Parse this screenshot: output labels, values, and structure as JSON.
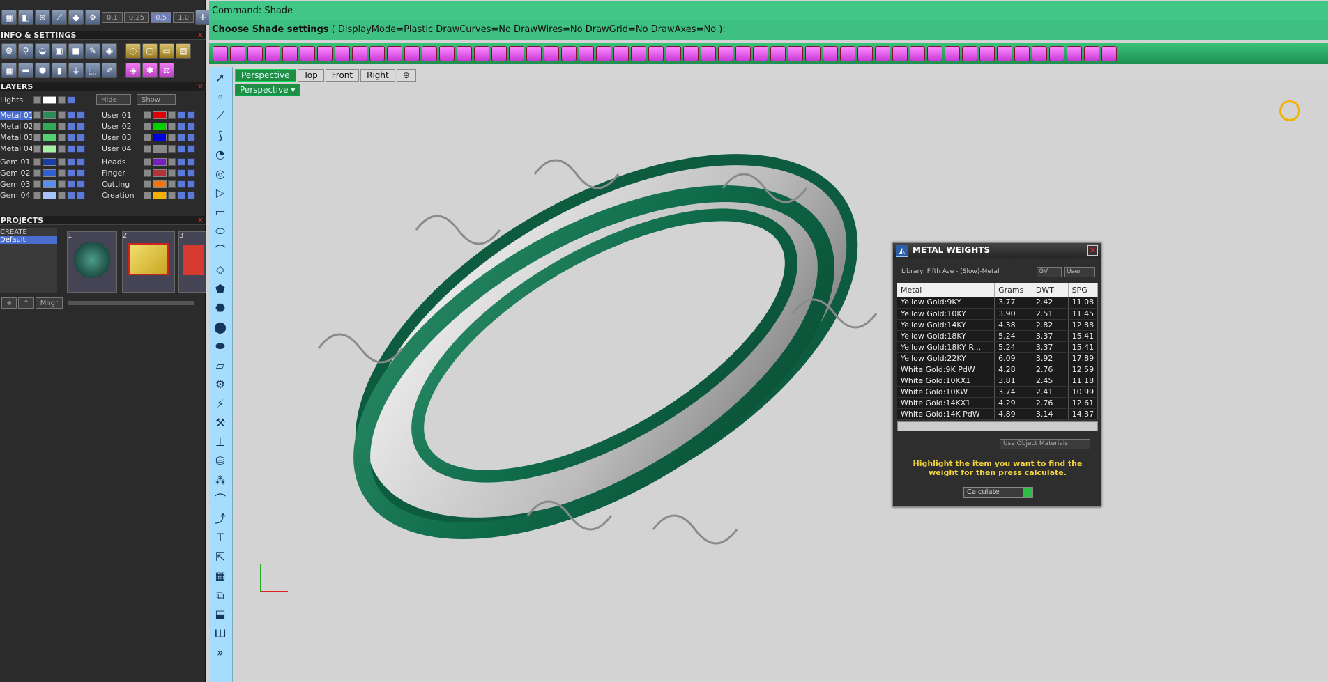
{
  "command": {
    "line1": "Command: Shade",
    "line2_bold": "Choose Shade settings",
    "line2_rest": "( DisplayMode=Plastic  DrawCurves=No  DrawWires=No  DrawGrid=No  DrawAxes=No ):"
  },
  "panel": {
    "info_title": "INFO & SETTINGS",
    "layers_title": "LAYERS",
    "projects_title": "PROJECTS",
    "values": [
      "0.1",
      "0.25",
      "0.5",
      "1.0"
    ],
    "lights_label": "Lights",
    "hide_label": "Hide",
    "show_label": "Show",
    "layers_left": [
      {
        "name": "Metal 01",
        "color": "#2e8b57"
      },
      {
        "name": "Metal 02",
        "color": "#33aa55"
      },
      {
        "name": "Metal 03",
        "color": "#55d070"
      },
      {
        "name": "Metal 04",
        "color": "#a6f0a6"
      },
      {
        "name": "Gem 01",
        "color": "#1a3ea8"
      },
      {
        "name": "Gem 02",
        "color": "#2f62d0"
      },
      {
        "name": "Gem 03",
        "color": "#5b8ef0"
      },
      {
        "name": "Gem 04",
        "color": "#a9c4f8"
      }
    ],
    "layers_right": [
      {
        "name": "User 01",
        "color": "#e00000"
      },
      {
        "name": "User 02",
        "color": "#00d000"
      },
      {
        "name": "User 03",
        "color": "#0000e0"
      },
      {
        "name": "User 04",
        "color": "#888888"
      },
      {
        "name": "Heads",
        "color": "#7a1fbf"
      },
      {
        "name": "Finger",
        "color": "#b3333a"
      },
      {
        "name": "Cutting",
        "color": "#ee7711"
      },
      {
        "name": "Creation",
        "color": "#f2b000"
      }
    ],
    "projects": [
      "CREATE",
      "Default"
    ],
    "thumbs": [
      "1",
      "2",
      "3"
    ],
    "mngr": "Mngr"
  },
  "tabs": [
    "Perspective",
    "Top",
    "Front",
    "Right"
  ],
  "viewport_label": "Perspective",
  "metal_weights": {
    "title": "METAL WEIGHTS",
    "library": "Library: Fifth Ave - (Slow)-Metal",
    "gv": "GV",
    "user": "User",
    "columns": [
      "Metal",
      "Grams",
      "DWT",
      "SPG"
    ],
    "rows": [
      [
        "Yellow Gold:9KY",
        "3.77",
        "2.42",
        "11.08"
      ],
      [
        "Yellow Gold:10KY",
        "3.90",
        "2.51",
        "11.45"
      ],
      [
        "Yellow Gold:14KY",
        "4.38",
        "2.82",
        "12.88"
      ],
      [
        "Yellow Gold:18KY",
        "5.24",
        "3.37",
        "15.41"
      ],
      [
        "Yellow Gold:18KY R...",
        "5.24",
        "3.37",
        "15.41"
      ],
      [
        "Yellow Gold:22KY",
        "6.09",
        "3.92",
        "17.89"
      ],
      [
        "White Gold:9K PdW",
        "4.28",
        "2.76",
        "12.59"
      ],
      [
        "White Gold:10KX1",
        "3.81",
        "2.45",
        "11.18"
      ],
      [
        "White Gold:10KW",
        "3.74",
        "2.41",
        "10.99"
      ],
      [
        "White Gold:14KX1",
        "4.29",
        "2.76",
        "12.61"
      ],
      [
        "White Gold:14K PdW",
        "4.89",
        "3.14",
        "14.37"
      ]
    ],
    "use_object_materials": "Use Object Materials",
    "message": "Highlight the item you want to find the weight for then press calculate.",
    "calculate": "Calculate"
  }
}
